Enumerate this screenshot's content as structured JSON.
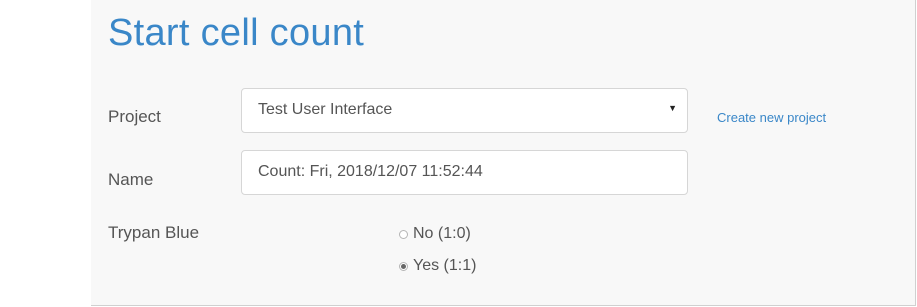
{
  "page": {
    "title": "Start cell count"
  },
  "form": {
    "project": {
      "label": "Project",
      "selected": "Test User Interface",
      "caret": "▼",
      "create_link": "Create new project"
    },
    "name": {
      "label": "Name",
      "value": "Count: Fri, 2018/12/07 11:52:44"
    },
    "trypan": {
      "label": "Trypan Blue",
      "options": [
        {
          "label": "No (1:0)",
          "checked": false
        },
        {
          "label": "Yes (1:1)",
          "checked": true
        }
      ]
    }
  },
  "colors": {
    "accent": "#3a87c8",
    "panel_bg": "#f8f8f8",
    "text": "#555555"
  }
}
